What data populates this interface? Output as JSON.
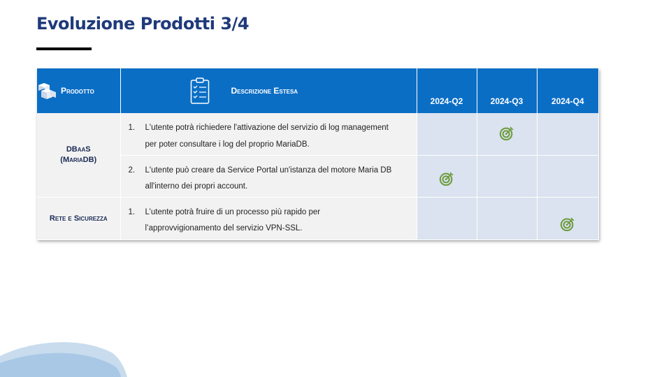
{
  "title": "Evoluzione Prodotti 3/4",
  "colors": {
    "header": "#0b6ec5",
    "title": "#1f3a7a",
    "target": "#6b9a3a",
    "quarter_cell": "#dae3ef"
  },
  "table": {
    "headers": {
      "prodotto": "Prodotto",
      "descrizione": "Descrizione Estesa",
      "q2": "2024-Q2",
      "q3": "2024-Q3",
      "q4": "2024-Q4"
    },
    "icons": {
      "prodotto": "cubes-icon",
      "descrizione": "clipboard-checklist-icon",
      "milestone": "target-icon"
    },
    "rows": [
      {
        "product": "DBaaS",
        "product_sub": "(MariaDB)",
        "num": "1.",
        "line1": "L'utente potrà richiedere l'attivazione del servizio di log management",
        "line2": "per poter consultare i log del proprio MariaDB.",
        "milestone": "2024-Q3"
      },
      {
        "num": "2.",
        "line1": "L'utente può creare da Service Portal un'istanza del motore Maria DB",
        "line2": "all'interno dei propri account.",
        "milestone": "2024-Q2"
      },
      {
        "product": "Rete e Sicurezza",
        "num": "1.",
        "line1": "L’utente potrà fruire di un processo più rapido per",
        "line2": "l’approvvigionamento del servizio VPN-SSL.",
        "milestone": "2024-Q4"
      }
    ]
  }
}
